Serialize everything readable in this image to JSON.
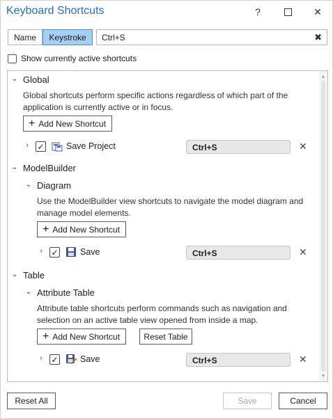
{
  "window": {
    "title": "Keyboard Shortcuts",
    "help": "?",
    "close": "✕"
  },
  "filter": {
    "name_label": "Name",
    "keystroke_label": "Keystroke",
    "search_value": "Ctrl+S",
    "clear": "✖"
  },
  "active_only_label": "Show currently active shortcuts",
  "groups": {
    "global": {
      "title": "Global",
      "description": "Global shortcuts perform specific actions regardless of which part of the application is currently active or in focus.",
      "add_label": "Add New Shortcut",
      "command": {
        "label": "Save Project",
        "key": "Ctrl+S",
        "icon": "save-project-icon"
      }
    },
    "modelbuilder": {
      "title": "ModelBuilder",
      "sub_title": "Diagram",
      "description": "Use the ModelBuilder view shortcuts to navigate the model diagram and manage model elements.",
      "add_label": "Add New Shortcut",
      "command": {
        "label": "Save",
        "key": "Ctrl+S",
        "icon": "save-icon"
      }
    },
    "table": {
      "title": "Table",
      "sub_title": "Attribute Table",
      "description": "Attribute table shortcuts perform commands such as navigation and selection on an active table view opened from inside a map.",
      "add_label": "Add New Shortcut",
      "reset_label": "Reset Table",
      "command": {
        "label": "Save",
        "key": "Ctrl+S",
        "icon": "save-edits-icon"
      }
    }
  },
  "footer": {
    "reset_all": "Reset All",
    "save": "Save",
    "cancel": "Cancel"
  },
  "colors": {
    "title": "#2a6fb0",
    "toggle_active": "#a7cff3",
    "key_box": "#e8e8e8"
  }
}
